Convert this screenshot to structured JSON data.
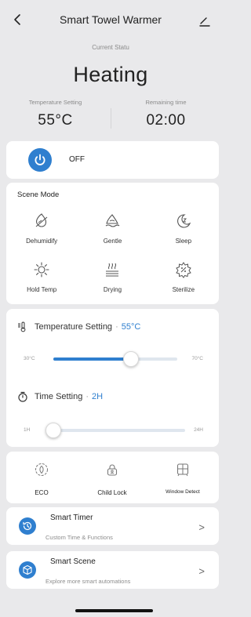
{
  "header": {
    "title": "Smart Towel Warmer"
  },
  "status": {
    "label": "Current Statu",
    "value": "Heating"
  },
  "stats": {
    "temperature": {
      "label": "Temperature Setting",
      "value": "55°C"
    },
    "remaining": {
      "label": "Remaining time",
      "value": "02:00"
    }
  },
  "power": {
    "label": "OFF"
  },
  "scene_mode": {
    "title": "Scene Mode",
    "items": [
      {
        "label": "Dehumidify",
        "icon": "dehumidify-icon"
      },
      {
        "label": "Gentle",
        "icon": "gentle-icon"
      },
      {
        "label": "Sleep",
        "icon": "sleep-icon"
      },
      {
        "label": "Hold Temp",
        "icon": "sun-icon"
      },
      {
        "label": "Drying",
        "icon": "drying-icon"
      },
      {
        "label": "Sterilize",
        "icon": "sterilize-icon"
      }
    ]
  },
  "temperature_setting": {
    "title": "Temperature Setting",
    "sep": "·",
    "value": "55°C",
    "min": "30°C",
    "max": "70°C",
    "fraction": 0.625
  },
  "time_setting": {
    "title": "Time Setting",
    "sep": "·",
    "value": "2H",
    "min": "1H",
    "max": "24H",
    "fraction": 0.043
  },
  "functions": {
    "eco": "ECO",
    "child_lock": "Child Lock",
    "window_detect": "Window Detect"
  },
  "smart_timer": {
    "title": "Smart Timer",
    "subtitle": "Custom Time & Functions",
    "chevron": ">"
  },
  "smart_scene": {
    "title": "Smart Scene",
    "subtitle": "Explore more smart automations",
    "chevron": ">"
  },
  "colors": {
    "accent": "#2f7fcf",
    "background": "#e9e9eb",
    "card": "#ffffff"
  }
}
